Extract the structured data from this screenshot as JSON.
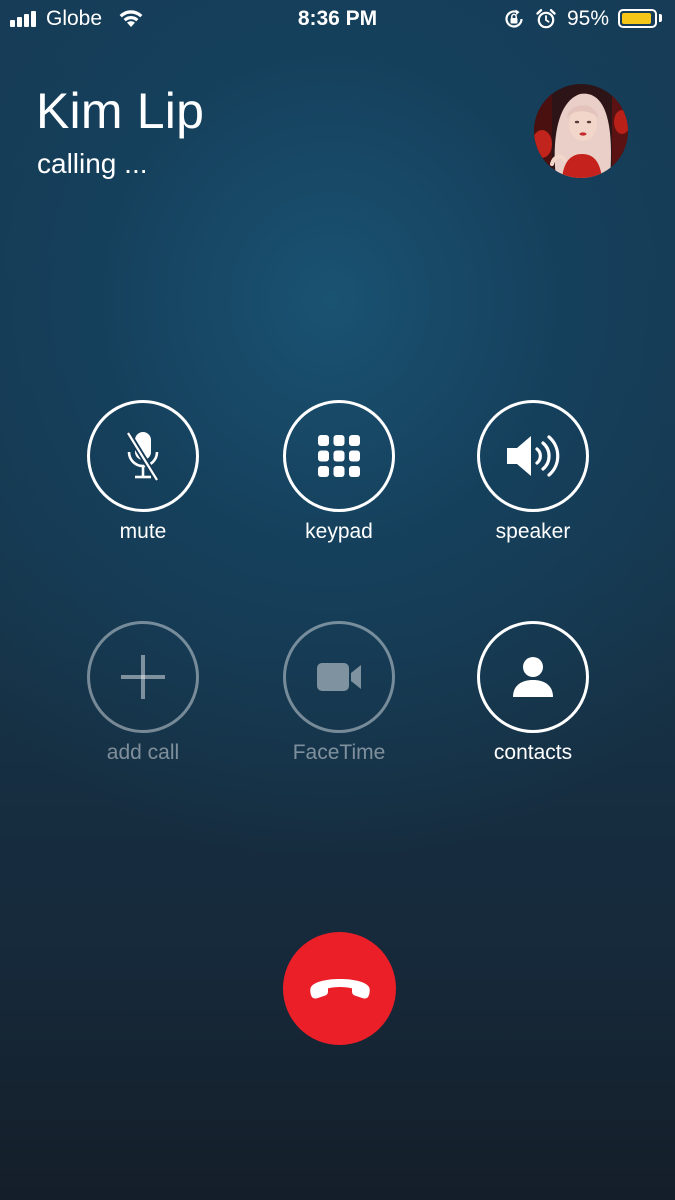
{
  "status_bar": {
    "carrier": "Globe",
    "time": "8:36 PM",
    "battery_percent": "95%",
    "battery_level": 0.95,
    "battery_color": "#f5c518",
    "icons": [
      "signal-bars-icon",
      "wifi-icon",
      "rotation-lock-icon",
      "alarm-icon",
      "battery-icon"
    ]
  },
  "call": {
    "caller_name": "Kim Lip",
    "status": "calling ..."
  },
  "controls": {
    "mute": {
      "label": "mute",
      "icon": "mic-off-icon",
      "enabled": true
    },
    "keypad": {
      "label": "keypad",
      "icon": "keypad-icon",
      "enabled": true
    },
    "speaker": {
      "label": "speaker",
      "icon": "speaker-icon",
      "enabled": true
    },
    "add_call": {
      "label": "add call",
      "icon": "plus-icon",
      "enabled": false
    },
    "facetime": {
      "label": "FaceTime",
      "icon": "video-camera-icon",
      "enabled": false
    },
    "contacts": {
      "label": "contacts",
      "icon": "person-icon",
      "enabled": true
    }
  },
  "end_call": {
    "icon": "end-call-icon",
    "color": "#eb1f27"
  }
}
